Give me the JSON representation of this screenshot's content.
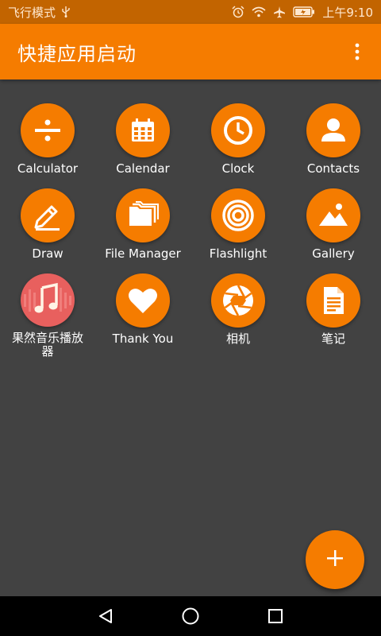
{
  "status_bar": {
    "left_text": "飞行模式",
    "time": "上午9:10",
    "icons": [
      "usb-icon",
      "alarm-icon",
      "wifi-icon",
      "airplane-icon",
      "battery-icon"
    ]
  },
  "app_bar": {
    "title": "快捷应用启动",
    "menu_icon": "more-vert-icon"
  },
  "apps": [
    {
      "label": "Calculator",
      "icon": "calculator-icon"
    },
    {
      "label": "Calendar",
      "icon": "calendar-icon"
    },
    {
      "label": "Clock",
      "icon": "clock-icon"
    },
    {
      "label": "Contacts",
      "icon": "contacts-icon"
    },
    {
      "label": "Draw",
      "icon": "draw-icon"
    },
    {
      "label": "File Manager",
      "icon": "folder-icon"
    },
    {
      "label": "Flashlight",
      "icon": "flashlight-icon"
    },
    {
      "label": "Gallery",
      "icon": "gallery-icon"
    },
    {
      "label": "果然音乐播放器",
      "icon": "music-icon"
    },
    {
      "label": "Thank You",
      "icon": "heart-icon"
    },
    {
      "label": "相机",
      "icon": "camera-icon"
    },
    {
      "label": "笔记",
      "icon": "notes-icon"
    }
  ],
  "fab": {
    "icon": "add-icon"
  },
  "nav_bar": {
    "icons": [
      "back-icon",
      "home-icon",
      "recents-icon"
    ]
  },
  "colors": {
    "accent": "#f57c00",
    "background": "#424242",
    "status_bar": "#c26400"
  }
}
